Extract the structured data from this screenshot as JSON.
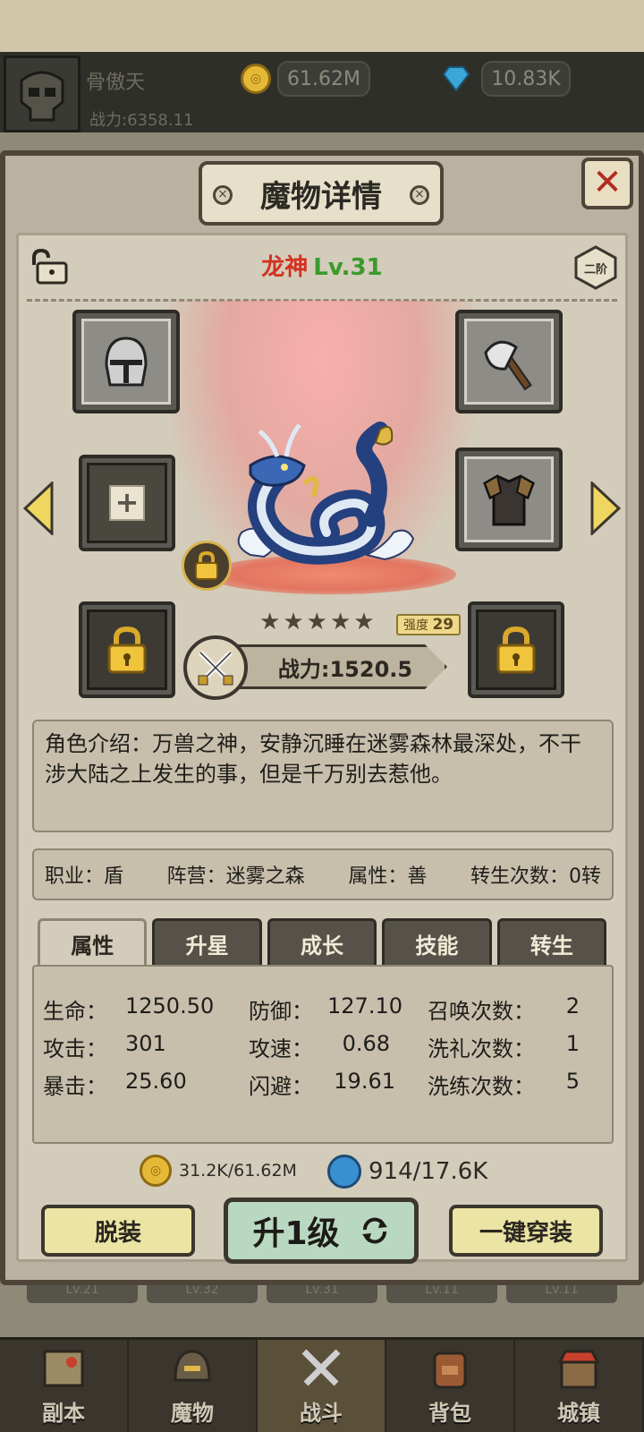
{
  "player": {
    "name": "骨傲天",
    "power": "战力:6358.11",
    "gold": "61.62M",
    "diamond": "10.83K"
  },
  "dialog": {
    "title": "魔物详情",
    "close_label": "✕"
  },
  "monster": {
    "name": "龙神",
    "level": "Lv.31",
    "stage": "二阶",
    "stars": 5,
    "strength_label": "强度",
    "strength_value": "29",
    "power": "战力:1520.5",
    "description": "角色介绍：万兽之神，安静沉睡在迷雾森林最深处，不干涉大陆之上发生的事，但是千万别去惹他。"
  },
  "info": {
    "job": "职业：盾",
    "camp": "阵营：迷雾之森",
    "attribute": "属性：善",
    "rebirth": "转生次数：0转"
  },
  "tabs": [
    "属性",
    "升星",
    "成长",
    "技能",
    "转生"
  ],
  "stats": {
    "hp_label": "生命：",
    "hp": "1250.50",
    "def_label": "防御：",
    "def": "127.10",
    "summon_label": "召唤次数：",
    "summon": "2",
    "atk_label": "攻击：",
    "atk": "301",
    "aspd_label": "攻速：",
    "aspd": "0.68",
    "baptism_label": "洗礼次数：",
    "baptism": "1",
    "crit_label": "暴击：",
    "crit": "25.60",
    "dodge_label": "闪避：",
    "dodge": "19.61",
    "refine_label": "洗练次数：",
    "refine": "5"
  },
  "costs": {
    "gold": "31.2K/61.62M",
    "orb": "914/17.6K"
  },
  "buttons": {
    "unequip": "脱装",
    "levelup": "升1级",
    "equip_all": "一键穿装"
  },
  "bg_levels": [
    "Lv.21",
    "Lv.32",
    "Lv.31",
    "Lv.11",
    "Lv.11"
  ],
  "nav": [
    "副本",
    "魔物",
    "战斗",
    "背包",
    "城镇"
  ],
  "colors": {
    "name_red": "#d3311f",
    "level_green": "#3a9a2c",
    "close_red": "#b12c22",
    "button_yellow": "#ebe4a4",
    "button_green": "#b9d8c1"
  }
}
